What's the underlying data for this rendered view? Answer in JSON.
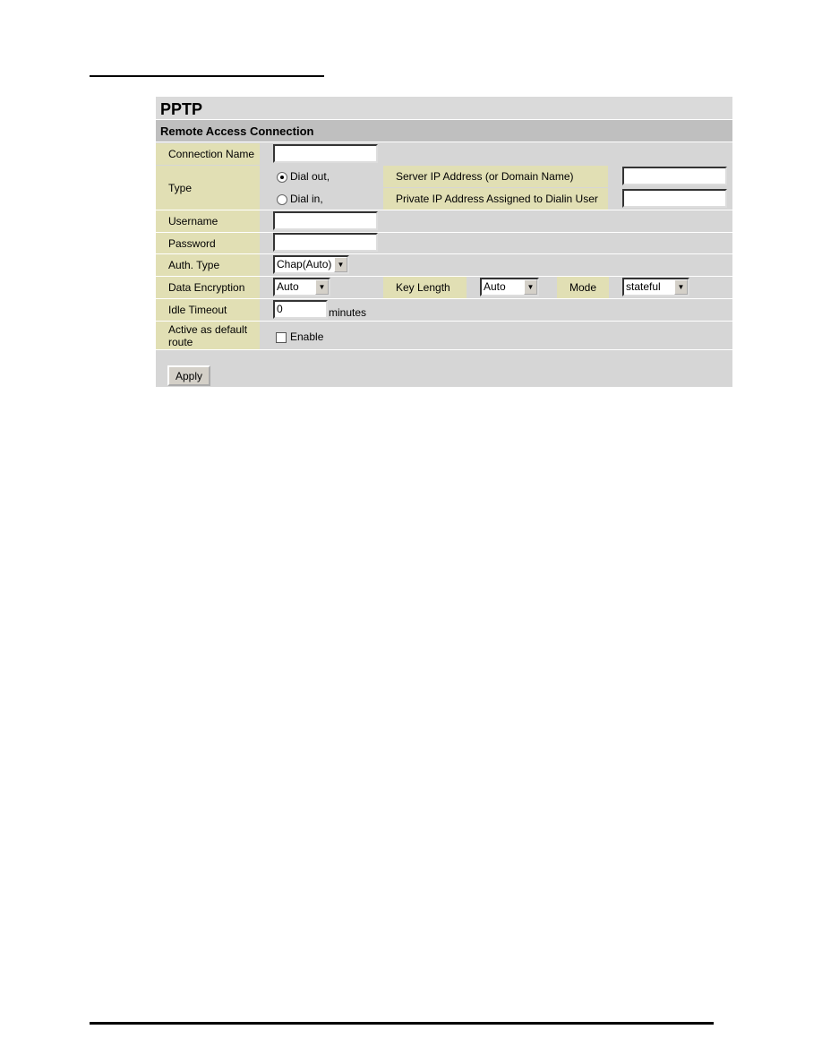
{
  "title": "PPTP",
  "section": "Remote Access Connection",
  "labels": {
    "connection_name": "Connection Name",
    "type": "Type",
    "username": "Username",
    "password": "Password",
    "auth_type": "Auth. Type",
    "data_encryption": "Data Encryption",
    "idle_timeout": "Idle Timeout",
    "active_default": "Active as default route",
    "server_ip": "Server IP Address (or Domain Name)",
    "private_ip": "Private IP Address Assigned to Dialin User",
    "key_length": "Key Length",
    "mode": "Mode"
  },
  "type_options": {
    "dial_out": "Dial out,",
    "dial_in": "Dial in,",
    "selected": "dial_out"
  },
  "values": {
    "connection_name": "",
    "username": "",
    "password": "",
    "server_ip": "",
    "private_ip": "",
    "auth_type": "Chap(Auto)",
    "data_encryption": "Auto",
    "key_length": "Auto",
    "mode": "stateful",
    "idle_timeout": "0",
    "idle_unit": "minutes",
    "enable": "Enable",
    "enable_checked": false
  },
  "apply": "Apply"
}
